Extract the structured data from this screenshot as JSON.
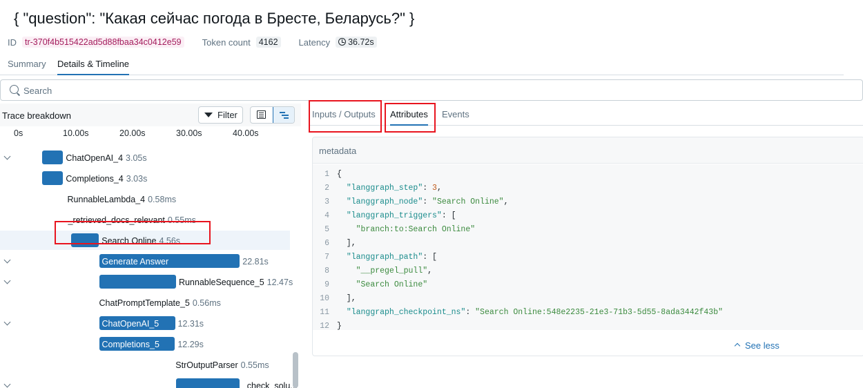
{
  "header": {
    "title": "{ \"question\": \"Какая сейчас погода в Бресте, Беларусь?\" }",
    "id_label": "ID",
    "id_value": "tr-370f4b515422ad5d88fbaa34c0412e59",
    "token_label": "Token count",
    "token_value": "4162",
    "latency_label": "Latency",
    "latency_value": "36.72s"
  },
  "tabs": {
    "summary": "Summary",
    "details": "Details & Timeline"
  },
  "search": {
    "placeholder": "Search"
  },
  "trace": {
    "title": "Trace breakdown",
    "filter_label": "Filter",
    "axis": [
      "0s",
      "10.00s",
      "20.00s",
      "30.00s",
      "40.00s"
    ],
    "spans": [
      {
        "name": "ChatOpenAI_4",
        "duration": "3.05s",
        "expandable": true,
        "start_pct": 10.42,
        "length_pct": 9.2,
        "label_inside": false
      },
      {
        "name": "Completions_4",
        "duration": "3.03s",
        "expandable": false,
        "start_pct": 10.42,
        "length_pct": 9.2,
        "label_inside": false
      },
      {
        "name": "RunnableLambda_4",
        "duration": "0.58ms",
        "expandable": false,
        "start_pct": 21.5,
        "length_pct": 0,
        "label_inside": false
      },
      {
        "name": "_retrieved_docs_relevant",
        "duration": "0.55ms",
        "expandable": false,
        "start_pct": 21.8,
        "length_pct": 0,
        "label_inside": false
      },
      {
        "name": "Search Online",
        "duration": "4.56s",
        "expandable": false,
        "start_pct": 23.02,
        "length_pct": 12.42,
        "label_inside": false,
        "selected": true
      },
      {
        "name": "Generate Answer",
        "duration": "22.81s",
        "expandable": true,
        "start_pct": 35.53,
        "length_pct": 62.12,
        "label_inside": true
      },
      {
        "name": "RunnableSequence_5",
        "duration": "12.47s",
        "expandable": true,
        "start_pct": 35.53,
        "length_pct": 33.97,
        "label_inside": false
      },
      {
        "name": "ChatPromptTemplate_5",
        "duration": "0.56ms",
        "expandable": false,
        "start_pct": 35.53,
        "length_pct": 0,
        "label_inside": false
      },
      {
        "name": "ChatOpenAI_5",
        "duration": "12.31s",
        "expandable": true,
        "start_pct": 35.53,
        "length_pct": 33.53,
        "label_inside": true
      },
      {
        "name": "Completions_5",
        "duration": "12.29s",
        "expandable": false,
        "start_pct": 35.53,
        "length_pct": 33.47,
        "label_inside": true
      },
      {
        "name": "StrOutputParser",
        "duration": "0.55ms",
        "expandable": false,
        "start_pct": 69.3,
        "length_pct": 0,
        "label_inside": false
      },
      {
        "name": "_check_solu...",
        "duration": "",
        "expandable": true,
        "start_pct": 69.5,
        "length_pct": 28.0,
        "label_inside": false
      }
    ]
  },
  "detail_tabs": {
    "io": "Inputs / Outputs",
    "attributes": "Attributes",
    "events": "Events"
  },
  "metadata": {
    "title": "metadata",
    "lines": [
      [
        [
          "p",
          "{"
        ]
      ],
      [
        [
          "p",
          "  "
        ],
        [
          "k",
          "\"langgraph_step\""
        ],
        [
          "p",
          ": "
        ],
        [
          "n",
          "3"
        ],
        [
          "p",
          ","
        ]
      ],
      [
        [
          "p",
          "  "
        ],
        [
          "k",
          "\"langgraph_node\""
        ],
        [
          "p",
          ": "
        ],
        [
          "s",
          "\"Search Online\""
        ],
        [
          "p",
          ","
        ]
      ],
      [
        [
          "p",
          "  "
        ],
        [
          "k",
          "\"langgraph_triggers\""
        ],
        [
          "p",
          ": ["
        ]
      ],
      [
        [
          "p",
          "    "
        ],
        [
          "s",
          "\"branch:to:Search Online\""
        ]
      ],
      [
        [
          "p",
          "  ],"
        ]
      ],
      [
        [
          "p",
          "  "
        ],
        [
          "k",
          "\"langgraph_path\""
        ],
        [
          "p",
          ": ["
        ]
      ],
      [
        [
          "p",
          "    "
        ],
        [
          "s",
          "\"__pregel_pull\""
        ],
        [
          "p",
          ","
        ]
      ],
      [
        [
          "p",
          "    "
        ],
        [
          "s",
          "\"Search Online\""
        ]
      ],
      [
        [
          "p",
          "  ],"
        ]
      ],
      [
        [
          "p",
          "  "
        ],
        [
          "k",
          "\"langgraph_checkpoint_ns\""
        ],
        [
          "p",
          ": "
        ],
        [
          "s",
          "\"Search Online:548e2235-21e3-71b3-5d55-8ada3442f43b\""
        ]
      ],
      [
        [
          "p",
          "}"
        ]
      ]
    ],
    "see_less": "See less"
  }
}
